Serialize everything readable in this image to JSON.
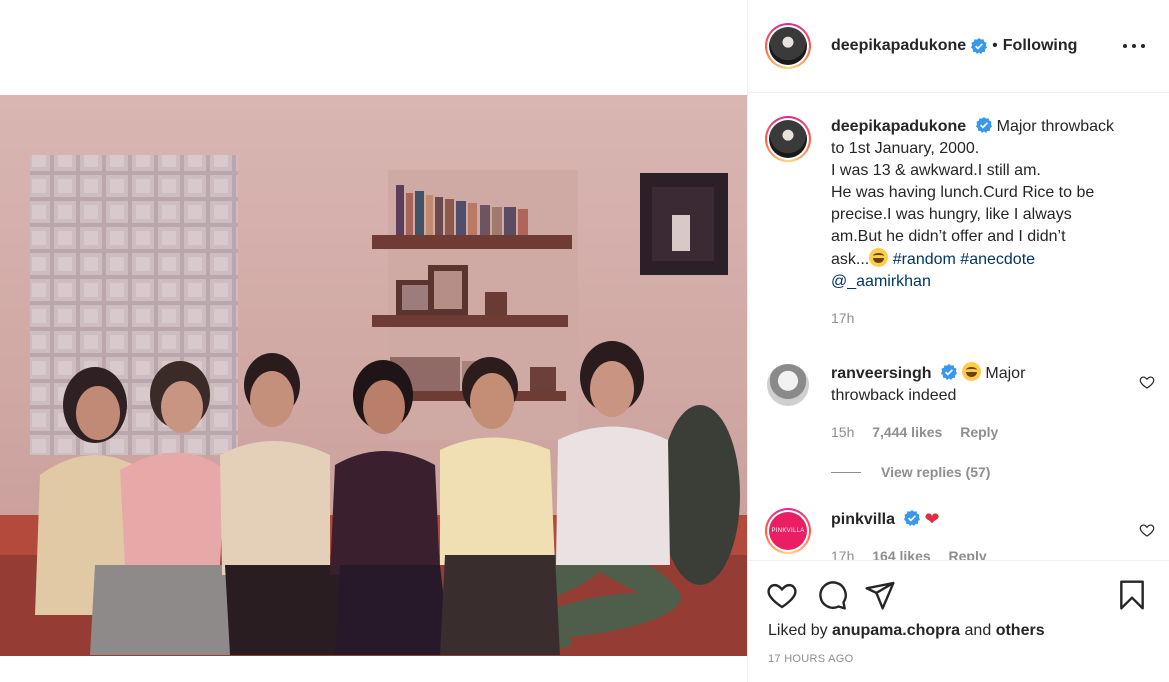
{
  "post": {
    "author": "deepikapadukone",
    "separator": "•",
    "follow_state": "Following",
    "more_icon": "ellipsis-icon",
    "caption": {
      "line1": "Major throwback",
      "line2": "to 1st January, 2000.",
      "line3": "I was 13 & awkward.I still am.",
      "line4": "He was having lunch.Curd Rice to be",
      "line5": "precise.I was hungry, like I always",
      "line6": "am.But he didn’t offer and I didn’t",
      "line7": "ask...",
      "hashtag1": "#random",
      "hashtag2": "#anecdote",
      "mention": "@_aamirkhan",
      "time": "17h"
    },
    "comments": [
      {
        "user": "ranveersingh",
        "text_line1": "Major",
        "text_line2": "throwback indeed",
        "time": "15h",
        "likes": "7,444 likes",
        "reply": "Reply",
        "view_replies": "View replies (57)"
      },
      {
        "user": "pinkvilla",
        "avatar_text": "PINKVILLA",
        "time": "17h",
        "likes": "164 likes",
        "reply": "Reply"
      }
    ],
    "liked_by_prefix": "Liked by",
    "liked_by_user": "anupama.chopra",
    "liked_by_and": "and",
    "liked_by_others": "others",
    "timestamp": "17 HOURS AGO"
  },
  "colors": {
    "verified": "#3897f0",
    "link": "#00376b",
    "muted": "#8e8e8e",
    "pinkvilla": "#e91e63"
  }
}
